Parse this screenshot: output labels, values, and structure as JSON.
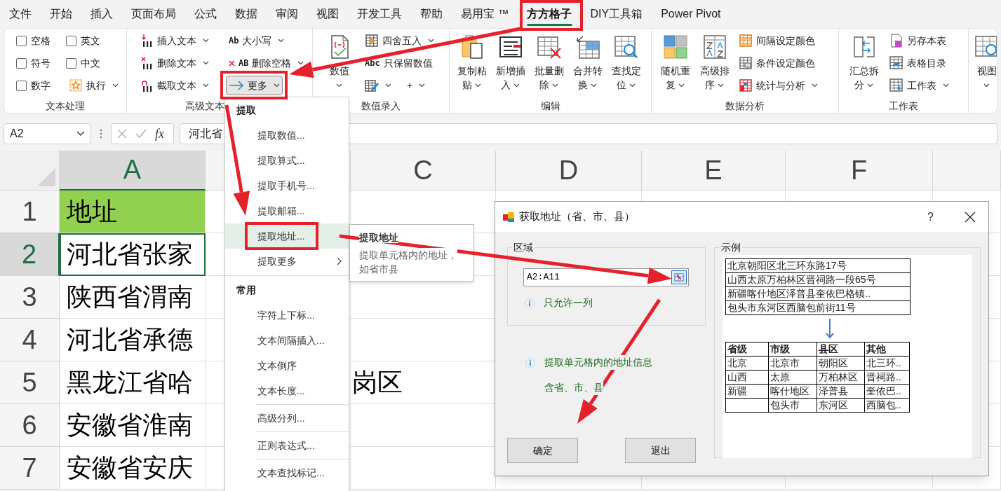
{
  "menu_tabs": [
    {
      "label": "文件",
      "selected": false
    },
    {
      "label": "开始",
      "selected": false
    },
    {
      "label": "插入",
      "selected": false
    },
    {
      "label": "页面布局",
      "selected": false
    },
    {
      "label": "公式",
      "selected": false
    },
    {
      "label": "数据",
      "selected": false
    },
    {
      "label": "审阅",
      "selected": false
    },
    {
      "label": "视图",
      "selected": false
    },
    {
      "label": "开发工具",
      "selected": false
    },
    {
      "label": "帮助",
      "selected": false
    },
    {
      "label": "易用宝 ™",
      "selected": false
    },
    {
      "label": "方方格子",
      "selected": true
    },
    {
      "label": "DIY工具箱",
      "selected": false
    },
    {
      "label": "Power Pivot",
      "selected": false
    }
  ],
  "ribbon_groups": [
    {
      "label": "文本处理",
      "columns": [
        {
          "kind": "stack",
          "items": [
            {
              "kind": "checkbox",
              "label": "空格",
              "checked": false
            },
            {
              "kind": "checkbox",
              "label": "符号",
              "checked": false
            },
            {
              "kind": "checkbox",
              "label": "数字",
              "checked": false
            }
          ]
        },
        {
          "kind": "stack",
          "items": [
            {
              "kind": "checkbox",
              "label": "英文",
              "checked": false
            },
            {
              "kind": "checkbox",
              "label": "中文",
              "checked": false
            },
            {
              "kind": "button",
              "label": "执行",
              "caret": true,
              "pressed": false
            }
          ]
        }
      ]
    },
    {
      "label": "高级文本",
      "columns": [
        {
          "kind": "stack",
          "items": [
            {
              "kind": "button",
              "label": "插入文本",
              "caret": true,
              "pressed": false
            },
            {
              "kind": "button",
              "label": "删除文本",
              "caret": true,
              "pressed": false
            },
            {
              "kind": "button",
              "label": "截取文本",
              "caret": true,
              "pressed": false
            }
          ]
        },
        {
          "kind": "stack",
          "items": [
            {
              "kind": "button",
              "icon_text": "Ab",
              "label": "大小写",
              "caret": true,
              "pressed": false
            },
            {
              "kind": "button",
              "icon_text": "AB",
              "label": "删除空格",
              "caret": true,
              "pressed": false
            },
            {
              "kind": "button",
              "label": "更多",
              "caret": true,
              "pressed": true
            }
          ]
        }
      ]
    },
    {
      "label": "数值录入",
      "columns": [
        {
          "kind": "large",
          "label": "数值",
          "caret": true
        },
        {
          "kind": "stack",
          "items": [
            {
              "kind": "button",
              "label": "四舍五入",
              "caret": true,
              "pressed": false
            },
            {
              "kind": "button",
              "icon_text": "Abc",
              "label": "只保留数值",
              "caret": false,
              "pressed": false
            },
            {
              "kind": "pair",
              "items": [
                {
                  "kind": "button",
                  "caret": true,
                  "pressed": false
                },
                {
                  "kind": "button",
                  "label": "+",
                  "caret": true,
                  "pressed": false
                }
              ]
            }
          ]
        }
      ]
    },
    {
      "label": "编辑",
      "columns": [
        {
          "kind": "large",
          "label": "复制粘贴",
          "caret": true
        },
        {
          "kind": "large",
          "label": "新增插入",
          "caret": true
        },
        {
          "kind": "large",
          "label": "批量删除",
          "caret": true
        },
        {
          "kind": "large",
          "label": "合并转换",
          "caret": true
        },
        {
          "kind": "large",
          "label": "查找定位",
          "caret": true
        }
      ]
    },
    {
      "label": "数据分析",
      "columns": [
        {
          "kind": "large",
          "label": "随机重复",
          "caret": true
        },
        {
          "kind": "large",
          "label": "高级排序",
          "caret": true
        },
        {
          "kind": "stack",
          "items": [
            {
              "kind": "button",
              "label": "间隔设定颜色",
              "caret": false,
              "pressed": false
            },
            {
              "kind": "button",
              "label": "条件设定颜色",
              "caret": false,
              "pressed": false
            },
            {
              "kind": "button",
              "label": "统计与分析",
              "caret": true,
              "pressed": false
            }
          ]
        }
      ]
    },
    {
      "label": "工作表",
      "columns": [
        {
          "kind": "large",
          "label": "汇总拆分",
          "caret": true
        },
        {
          "kind": "stack",
          "items": [
            {
              "kind": "button",
              "label": "另存本表",
              "caret": false,
              "pressed": false
            },
            {
              "kind": "button",
              "label": "表格目录",
              "caret": false,
              "pressed": false
            },
            {
              "kind": "button",
              "label": "工作表",
              "caret": true,
              "pressed": false
            }
          ]
        }
      ]
    },
    {
      "columns": [
        {
          "kind": "large",
          "label": "视图",
          "caret": true
        }
      ]
    }
  ],
  "formula_bar": {
    "name_box": "A2",
    "fx": "fx",
    "formula": "河北省"
  },
  "sheet": {
    "columns": [
      {
        "label": "A",
        "selected": true
      },
      {
        "selected": false
      },
      {
        "label": "C",
        "selected": false
      },
      {
        "label": "D",
        "selected": false
      },
      {
        "label": "E",
        "selected": false
      },
      {
        "label": "F",
        "selected": false
      },
      {
        "selected": false
      }
    ],
    "rows": [
      {
        "number": "1",
        "selected": false,
        "cells": [
          {
            "text": "地址",
            "filled": true,
            "selected": false
          }
        ]
      },
      {
        "number": "2",
        "selected": true,
        "cells": [
          {
            "text": "河北省张家",
            "filled": false,
            "selected": true
          }
        ]
      },
      {
        "number": "3",
        "selected": false,
        "cells": [
          {
            "text": "陕西省渭南",
            "filled": false,
            "selected": false
          }
        ]
      },
      {
        "number": "4",
        "selected": false,
        "cells": [
          {
            "text": "河北省承德",
            "filled": false,
            "selected": false
          }
        ]
      },
      {
        "number": "5",
        "selected": false,
        "cells": [
          {
            "text": "黑龙江省哈",
            "filled": false,
            "selected": false
          },
          null,
          {
            "text": "岗区",
            "filled": false,
            "selected": false
          }
        ]
      },
      {
        "number": "6",
        "selected": false,
        "cells": [
          {
            "text": "安徽省淮南",
            "filled": false,
            "selected": false
          }
        ]
      },
      {
        "number": "7",
        "selected": false,
        "cells": [
          {
            "text": "安徽省安庆",
            "filled": false,
            "selected": false
          }
        ]
      }
    ]
  },
  "dropdown_menu": {
    "sections": [
      {
        "title": "提取",
        "items": [
          {
            "label": "提取数值...",
            "selected": false,
            "submenu": false,
            "separator_before": false
          },
          {
            "label": "提取算式...",
            "selected": false,
            "submenu": false,
            "separator_before": false
          },
          {
            "label": "提取手机号...",
            "selected": false,
            "submenu": false,
            "separator_before": false
          },
          {
            "label": "提取邮箱...",
            "selected": false,
            "submenu": false,
            "separator_before": false
          },
          {
            "label": "提取地址...",
            "selected": true,
            "submenu": false,
            "separator_before": false
          },
          {
            "label": "提取更多",
            "selected": false,
            "submenu": true,
            "separator_before": false
          }
        ]
      },
      {
        "title": "常用",
        "items": [
          {
            "label": "字符上下标...",
            "selected": false,
            "submenu": false,
            "separator_before": false
          },
          {
            "label": "文本间隔插入...",
            "selected": false,
            "submenu": false,
            "separator_before": false
          },
          {
            "label": "文本倒序",
            "selected": false,
            "submenu": false,
            "separator_before": false
          },
          {
            "label": "文本长度...",
            "selected": false,
            "submenu": false,
            "separator_before": false
          },
          {
            "label": "高级分列...",
            "selected": false,
            "submenu": false,
            "separator_before": true
          },
          {
            "label": "正则表达式...",
            "selected": false,
            "submenu": false,
            "separator_before": true
          },
          {
            "label": "文本查找标记...",
            "selected": false,
            "submenu": false,
            "separator_before": true
          }
        ]
      }
    ]
  },
  "tooltip": {
    "title": "提取地址",
    "text": "提取单元格内的地址，如省市县"
  },
  "dialog": {
    "title": "获取地址（省、市、县）",
    "help": "?",
    "region": {
      "label": "区域",
      "value": "A2:A11",
      "note": "只允许一列"
    },
    "info": [
      "提取单元格内的地址信息",
      "含省、市、县"
    ],
    "buttons": [
      "确定",
      "退出"
    ],
    "example": {
      "label": "示例",
      "source_rows": [
        "北京朝阳区北三环东路17号",
        "山西太原万柏林区晋祠路一段65号",
        "新疆喀什地区泽普县奎依巴格镇..",
        "包头市东河区西脑包前街11号"
      ],
      "result_columns": [
        "省级",
        "市级",
        "县区",
        "其他"
      ],
      "result_rows": [
        [
          "北京",
          "北京市",
          "朝阳区",
          "北三环.."
        ],
        [
          "山西",
          "太原",
          "万柏林区",
          "晋祠路.."
        ],
        [
          "新疆",
          "喀什地区",
          "泽普县",
          "奎依巴.."
        ],
        [
          null,
          "包头市",
          "东河区",
          "西脑包.."
        ]
      ]
    }
  }
}
